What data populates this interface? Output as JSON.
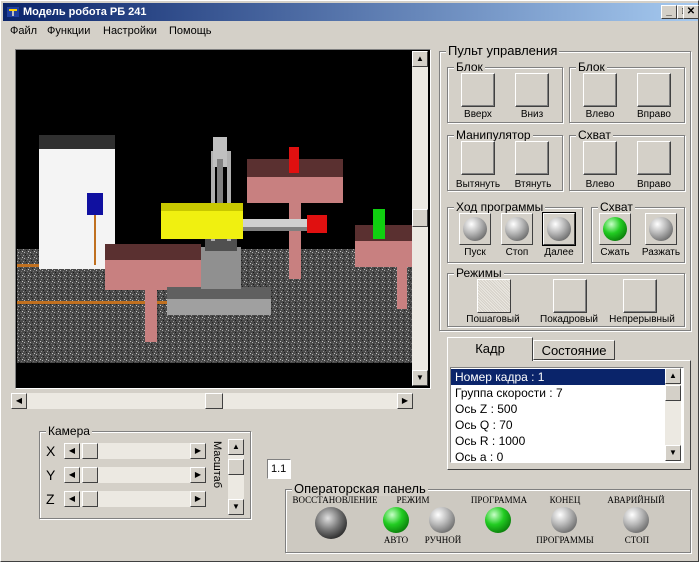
{
  "window": {
    "title": "Модель робота РБ 241",
    "minimize": "_",
    "maximize": "□",
    "close": "✕"
  },
  "menu": [
    "Файл",
    "Функции",
    "Настройки",
    "Помощь"
  ],
  "control": {
    "title": "Пульт управления",
    "block1": {
      "title": "Блок",
      "up": "Вверх",
      "down": "Вниз"
    },
    "block2": {
      "title": "Блок",
      "left": "Влево",
      "right": "Вправо"
    },
    "manip": {
      "title": "Манипулятор",
      "extend": "Вытянуть",
      "retract": "Втянуть"
    },
    "grip1": {
      "title": "Схват",
      "left": "Влево",
      "right": "Вправо"
    },
    "program": {
      "title": "Ход программы",
      "start": "Пуск",
      "stop": "Стоп",
      "next": "Далее"
    },
    "grip2": {
      "title": "Схват",
      "close": "Сжать",
      "open": "Разжать"
    },
    "modes": {
      "title": "Режимы",
      "step": "Пошаговый",
      "frame": "Покадровый",
      "cont": "Непрерывный"
    }
  },
  "tabs": {
    "frame": "Кадр",
    "state": "Состояние"
  },
  "frame_list": [
    "Номер кадра : 1",
    "Группа скорости : 7",
    "Ось Z : 500",
    "Ось Q : 70",
    "Ось R : 1000",
    "Ось а : 0"
  ],
  "camera": {
    "title": "Камера",
    "x": "X",
    "y": "Y",
    "z": "Z",
    "scale": "Масштаб",
    "scale_value": "1.1"
  },
  "operator": {
    "title": "Операторская панель",
    "restore": "ВОССТАНОВЛЕНИЕ",
    "mode": "РЕЖИМ",
    "auto": "АВТО",
    "manual": "РУЧНОЙ",
    "program": "ПРОГРАММА",
    "end_top": "КОНЕЦ",
    "end_bottom": "ПРОГРАММЫ",
    "emergency_top": "АВАРИЙНЫЙ",
    "emergency_bottom": "СТОП"
  },
  "colors": {
    "title_start": "#0a246a",
    "title_end": "#a6caf0",
    "led_green": "#22cc22",
    "selection": "#0a246a"
  }
}
